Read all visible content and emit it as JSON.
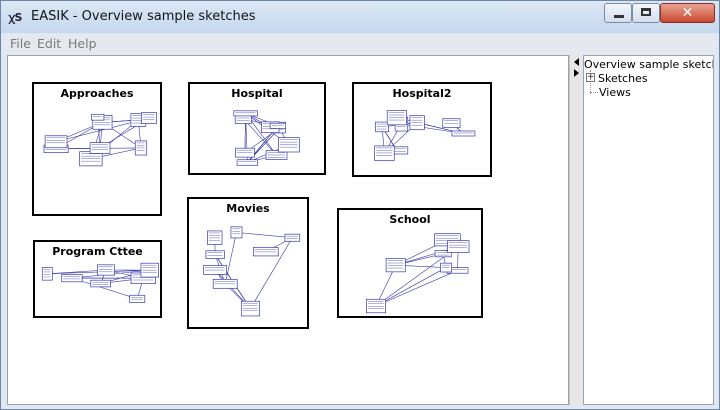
{
  "window": {
    "title": "EASIK - Overview sample sketches",
    "icon": "easik-app-icon",
    "controls": {
      "minimize": "minimize-icon",
      "maximize": "maximize-icon",
      "close": "close-icon",
      "close_glyph": "✕"
    }
  },
  "menu": {
    "file": "File",
    "edit": "Edit",
    "help": "Help"
  },
  "sketches": [
    {
      "name": "Approaches"
    },
    {
      "name": "Hospital"
    },
    {
      "name": "Hospital2"
    },
    {
      "name": "Movies"
    },
    {
      "name": "Program Cttee"
    },
    {
      "name": "School"
    }
  ],
  "tree": {
    "root": "Overview sample sketches",
    "items": [
      "Sketches",
      "Views"
    ],
    "expander_symbol": "+"
  },
  "colors": {
    "diagram": "#3a3aa8",
    "frame": "#000000"
  }
}
